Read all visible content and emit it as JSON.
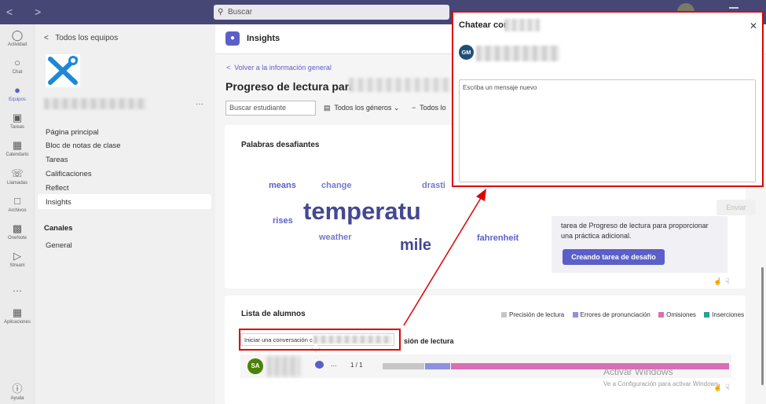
{
  "search": {
    "placeholder": "Buscar"
  },
  "rail": [
    {
      "label": "Actividad",
      "icon": "bell-icon"
    },
    {
      "label": "Chat",
      "icon": "chat-icon"
    },
    {
      "label": "Equipos",
      "icon": "teams-icon"
    },
    {
      "label": "Tareas",
      "icon": "assignments-icon"
    },
    {
      "label": "Calendario",
      "icon": "calendar-icon"
    },
    {
      "label": "Llamadas",
      "icon": "phone-icon"
    },
    {
      "label": "Archivos",
      "icon": "files-icon"
    },
    {
      "label": "OneNote",
      "icon": "onenote-icon"
    },
    {
      "label": "Stream",
      "icon": "stream-icon"
    },
    {
      "label": "Aplicaciones",
      "icon": "apps-icon"
    },
    {
      "label": "Ayuda",
      "icon": "help-icon"
    }
  ],
  "teampanel": {
    "back": "Todos los equipos",
    "links": [
      "Página principal",
      "Bloc de notas de clase",
      "Tareas",
      "Calificaciones",
      "Reflect",
      "Insights"
    ],
    "section": "Canales",
    "channel": "General"
  },
  "header": {
    "title": "Insights"
  },
  "main": {
    "back": "Volver a la información general",
    "title": "Progreso de lectura para",
    "student_search_placeholder": "Buscar estudiante",
    "filter_genres": "Todos los géneros",
    "filter_other": "Todos lo"
  },
  "words_card": {
    "title": "Palabras desafiantes",
    "words": [
      "means",
      "change",
      "drasti",
      "rises",
      "temperatu",
      "weather",
      "mile",
      "fahrenheit"
    ]
  },
  "info_box": {
    "text": "tarea de Progreso de lectura para proporcionar una práctica adicional.",
    "button": "Creando tarea de desafío"
  },
  "students_card": {
    "title": "Lista de alumnos",
    "legend": [
      "Precisión de lectura",
      "Errores de pronunciación",
      "Omisiones",
      "Inserciones"
    ],
    "column": "sión de lectura",
    "row": {
      "initials": "SA",
      "more": "...",
      "fraction": "1 / 1"
    }
  },
  "tooltip": {
    "text": "Iniciar una conversación c"
  },
  "watermark": {
    "line1": "Activar Windows",
    "line2": "Ve a Configuración para activar Windows."
  },
  "chat": {
    "title": "Chatear con",
    "recipient_initials": "GM",
    "message_placeholder": "Escriba un mensaje nuevo",
    "send": "Enviar"
  },
  "colors": {
    "topbar": "#464775",
    "accent": "#5b5fc7",
    "highlight_box": "#e00000",
    "bar_accuracy": "#c7c7c7",
    "bar_pronunciation": "#8f91e0",
    "bar_omissions": "#d86fb6",
    "bar_insertions": "#2aa198"
  },
  "bar_fractions": {
    "accuracy": 0.12,
    "pronunciation": 0.07,
    "omissions": 0.81
  }
}
